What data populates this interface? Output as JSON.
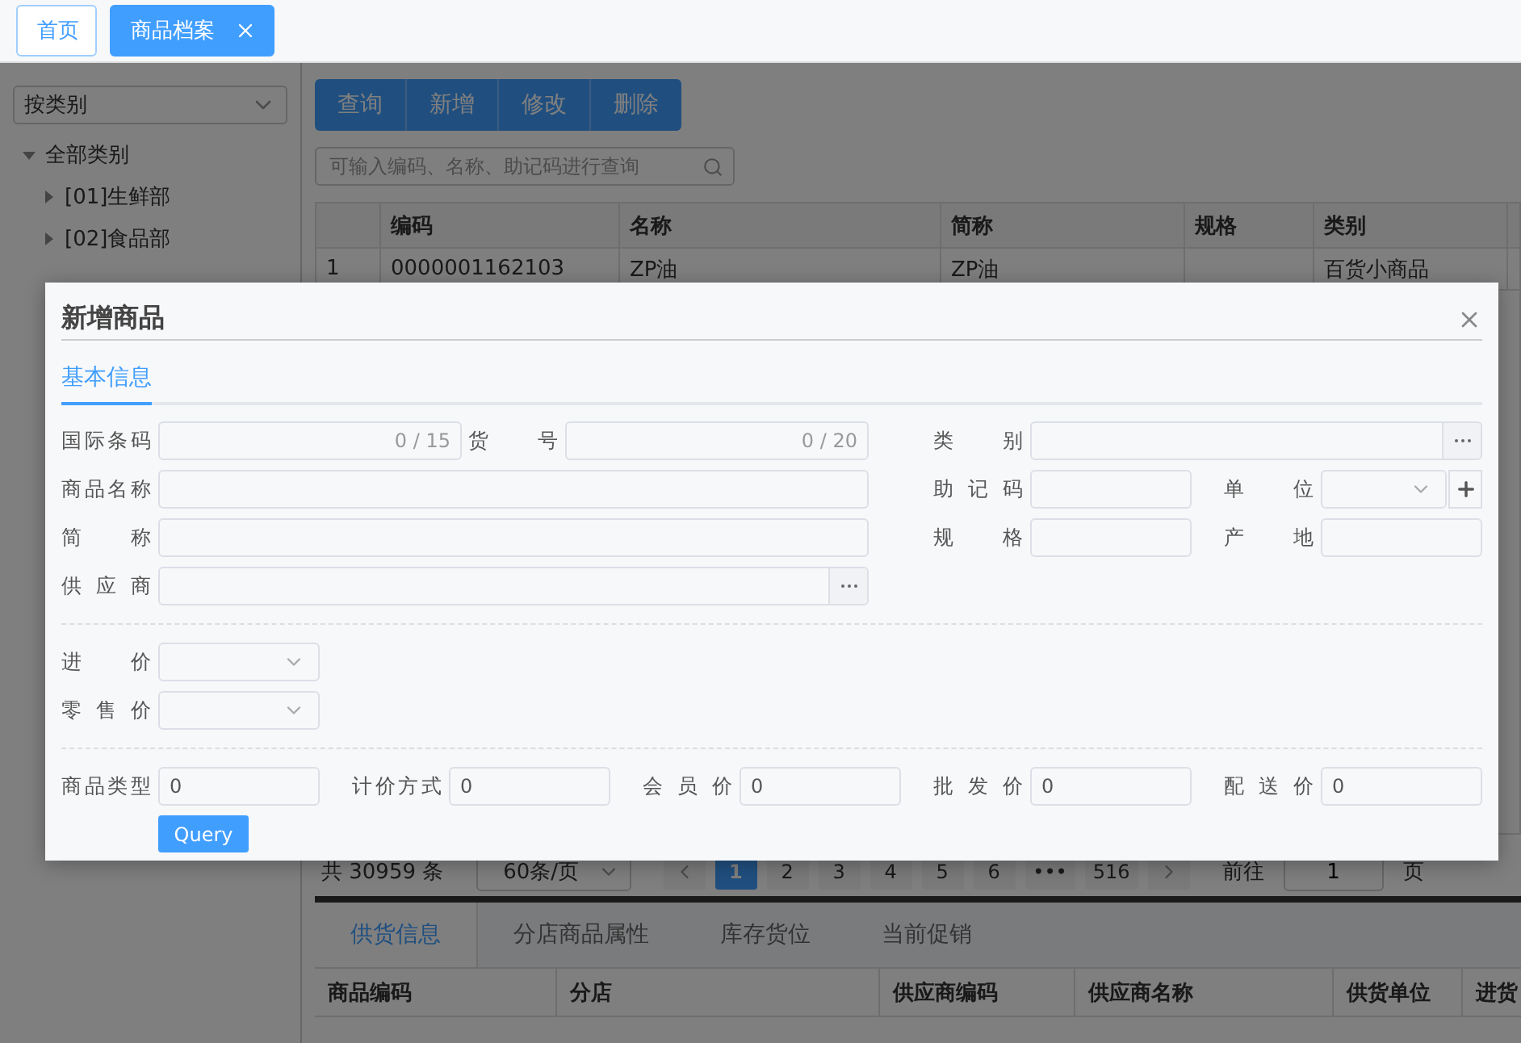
{
  "top_tabs": [
    {
      "label": "首页",
      "selected": false,
      "closable": false
    },
    {
      "label": "商品档案",
      "selected": true,
      "closable": true
    }
  ],
  "sidebar": {
    "filter": "按类别",
    "tree": [
      {
        "label": "全部类别",
        "expanded": true,
        "children": [
          {
            "label": "[01]生鲜部",
            "expanded": false
          },
          {
            "label": "[02]食品部",
            "expanded": false
          }
        ]
      }
    ]
  },
  "toolbar": [
    "查询",
    "新增",
    "修改",
    "删除"
  ],
  "search": {
    "placeholder": "可输入编码、名称、助记码进行查询"
  },
  "table": {
    "columns": [
      "编码",
      "名称",
      "简称",
      "规格",
      "类别"
    ],
    "rows": [
      {
        "index": "1",
        "code": "0000001162103",
        "name": "ZP油",
        "short_name": "ZP油",
        "category": "百货小商品"
      }
    ]
  },
  "pagination": {
    "total": "共 30959 条",
    "page_size": "60条/页",
    "pages": [
      {
        "label": "1",
        "selected": true
      },
      {
        "label": "2",
        "selected": false
      },
      {
        "label": "3",
        "selected": false
      },
      {
        "label": "4",
        "selected": false
      },
      {
        "label": "5",
        "selected": false
      },
      {
        "label": "6",
        "selected": false
      },
      {
        "label": "•••",
        "selected": false
      },
      {
        "label": "516",
        "selected": false
      }
    ],
    "goto_label": "前往",
    "goto_value": "1",
    "page_suffix": "页"
  },
  "detail_tabs": [
    {
      "label": "供货信息",
      "selected": true
    },
    {
      "label": "分店商品属性",
      "selected": false
    },
    {
      "label": "库存货位",
      "selected": false
    },
    {
      "label": "当前促销",
      "selected": false
    }
  ],
  "detail_table": {
    "columns": [
      "商品编码",
      "分店",
      "供应商编码",
      "供应商名称",
      "供货单位",
      "进货"
    ]
  },
  "dialog": {
    "title": "新增商品",
    "tabs": [
      {
        "label": "基本信息",
        "selected": true
      }
    ],
    "left_rows": [
      [
        {
          "label": "国际条码",
          "kind": "counter",
          "counter": "0 / 15"
        },
        {
          "label": "货 号",
          "kind": "counter",
          "counter": "0 / 20"
        }
      ],
      [
        {
          "label": "商品名称",
          "kind": "text"
        }
      ],
      [
        {
          "label": "简 称",
          "kind": "text"
        }
      ],
      [
        {
          "label": "供 应 商",
          "kind": "picker"
        }
      ]
    ],
    "right_rows": [
      [
        {
          "label": "类 别",
          "kind": "picker"
        }
      ],
      [
        {
          "label": "助 记 码",
          "kind": "text"
        },
        {
          "label": "单 位",
          "kind": "select_add"
        }
      ],
      [
        {
          "label": "规 格",
          "kind": "text"
        },
        {
          "label": "产 地",
          "kind": "text"
        }
      ]
    ],
    "price_fields": [
      {
        "label": "进 价",
        "kind": "select"
      },
      {
        "label": "零 售 价",
        "kind": "select"
      }
    ],
    "bottom_fields": [
      {
        "label": "商品类型",
        "kind": "text",
        "value": "0"
      },
      {
        "label": "计价方式",
        "kind": "text",
        "value": "0"
      },
      {
        "label": "会 员 价",
        "kind": "text",
        "value": "0"
      },
      {
        "label": "批 发 价",
        "kind": "text",
        "value": "0"
      },
      {
        "label": "配 送 价",
        "kind": "text",
        "value": "0"
      }
    ],
    "submit": "Query"
  }
}
